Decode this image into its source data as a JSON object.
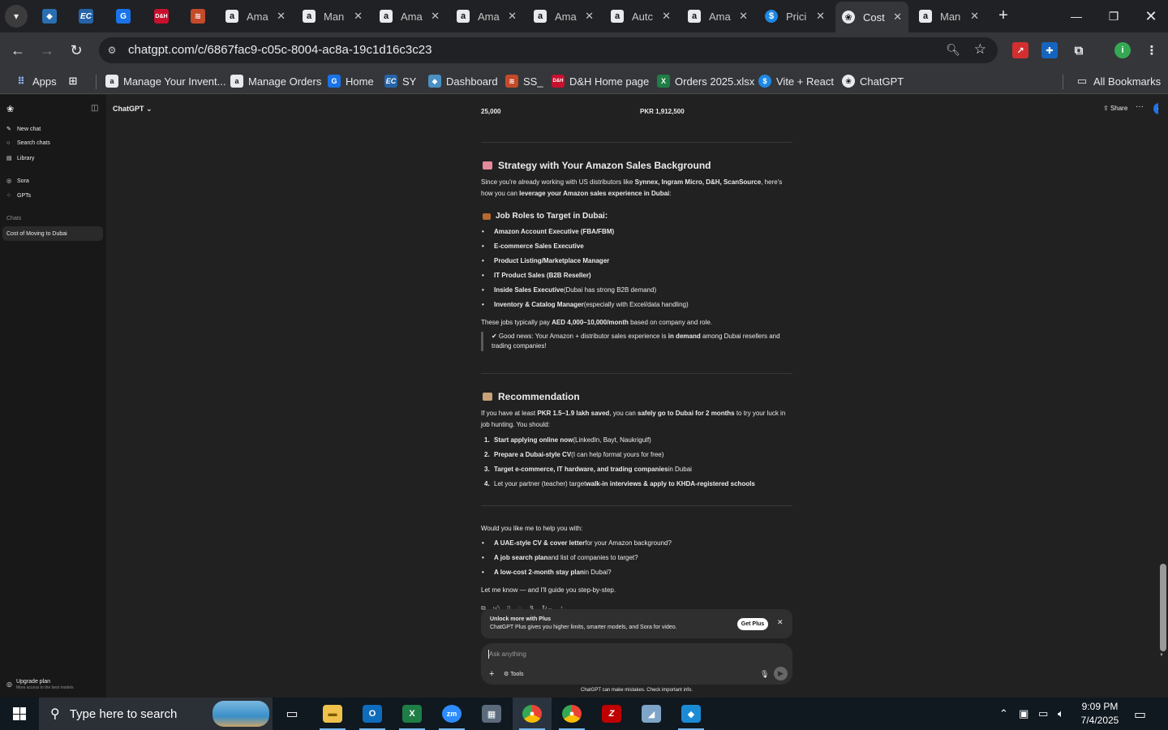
{
  "browser": {
    "tabs": [
      {
        "label": "Ama",
        "favicon": "amazon-icon"
      },
      {
        "label": "Man",
        "favicon": "amazon-icon"
      },
      {
        "label": "Ama",
        "favicon": "amazon-icon"
      },
      {
        "label": "Ama",
        "favicon": "amazon-icon"
      },
      {
        "label": "Ama",
        "favicon": "amazon-icon"
      },
      {
        "label": "Autc",
        "favicon": "amazon-icon"
      },
      {
        "label": "Ama",
        "favicon": "amazon-icon"
      },
      {
        "label": "Prici",
        "favicon": "dollar-icon"
      },
      {
        "label": "Cost",
        "favicon": "chatgpt-icon",
        "active": true
      },
      {
        "label": "Man",
        "favicon": "amazon-icon"
      }
    ],
    "url": "chatgpt.com/c/6867fac9-c05c-8004-ac8a-19c1d16c3c23",
    "bookmarks": [
      {
        "label": "Apps",
        "icon": "apps-grid-icon"
      },
      {
        "label": "Manage Your Invent...",
        "icon": "amazon-icon"
      },
      {
        "label": "Manage Orders",
        "icon": "amazon-icon"
      },
      {
        "label": "Home",
        "icon": "home-icon"
      },
      {
        "label": "SY",
        "icon": "ec-icon"
      },
      {
        "label": "Dashboard",
        "icon": "dashboard-icon"
      },
      {
        "label": "SS_",
        "icon": "ss-icon"
      },
      {
        "label": "D&H Home page",
        "icon": "dh-icon"
      },
      {
        "label": "Orders 2025.xlsx",
        "icon": "excel-icon"
      },
      {
        "label": "Vite + React",
        "icon": "dollar-icon"
      },
      {
        "label": "ChatGPT",
        "icon": "chatgpt-icon"
      }
    ],
    "all_bookmarks": "All Bookmarks",
    "profile_initial": "i"
  },
  "sidebar": {
    "items": [
      "New chat",
      "Search chats",
      "Library",
      "Sora",
      "GPTs"
    ],
    "section": "Chats",
    "chats": [
      "Cost of Moving to Dubai"
    ],
    "upgrade_title": "Upgrade plan",
    "upgrade_sub": "More access to the best models"
  },
  "topbar": {
    "model": "ChatGPT",
    "share": "Share"
  },
  "message": {
    "table_row": {
      "left": "25,000",
      "right": "PKR 1,912,500"
    },
    "strategy_heading": "Strategy with Your Amazon Sales Background",
    "strategy_p1": "Since you're already working with US distributors like ",
    "strategy_p1b": "Synnex, Ingram Micro, D&H, ScanSource",
    "strategy_p1c": ", here's how you can ",
    "strategy_p1d": "leverage your Amazon sales experience in Dubai",
    "strategy_p1e": ":",
    "jobs_heading": "Job Roles to Target in Dubai:",
    "jobs": [
      {
        "bold": "Amazon Account Executive (FBA/FBM)",
        "rest": ""
      },
      {
        "bold": "E-commerce Sales Executive",
        "rest": ""
      },
      {
        "bold": "Product Listing/Marketplace Manager",
        "rest": ""
      },
      {
        "bold": "IT Product Sales (B2B Reseller)",
        "rest": ""
      },
      {
        "bold": "Inside Sales Executive",
        "rest": " (Dubai has strong B2B demand)"
      },
      {
        "bold": "Inventory & Catalog Manager",
        "rest": " (especially with Excel/data handling)"
      }
    ],
    "pay_a": "These jobs typically pay ",
    "pay_b": "AED 4,000–10,000/month",
    "pay_c": " based on company and role.",
    "quote_a": "✔ Good news: Your Amazon + distributor sales experience is ",
    "quote_b": "in demand",
    "quote_c": " among Dubai resellers and trading companies!",
    "rec_heading": "Recommendation",
    "rec_a": "If you have at least ",
    "rec_b": "PKR 1.5–1.9 lakh saved",
    "rec_c": ", you can ",
    "rec_d": "safely go to Dubai for 2 months",
    "rec_e": " to try your luck in job hunting. You should:",
    "steps": [
      {
        "n": "1.",
        "bold": "Start applying online now",
        "rest": " (LinkedIn, Bayt, Naukrigulf)"
      },
      {
        "n": "2.",
        "bold": "Prepare a Dubai-style CV",
        "rest": " (I can help format yours for free)"
      },
      {
        "n": "3.",
        "bold": "Target e-commerce, IT hardware, and trading companies",
        "rest": " in Dubai"
      },
      {
        "n": "4.",
        "bold": "Let your partner (teacher) target ",
        "bold2": "walk-in interviews & apply to KHDA-registered schools",
        "rest": ""
      }
    ],
    "help_intro": "Would you like me to help you with:",
    "help": [
      {
        "bold": "A UAE-style CV & cover letter",
        "rest": " for your Amazon background?"
      },
      {
        "bold": "A job search plan",
        "rest": " and list of companies to target?"
      },
      {
        "bold": "A low-cost 2-month stay plan",
        "rest": " in Dubai?"
      }
    ],
    "closing": "Let me know — and I'll guide you step-by-step."
  },
  "plus_card": {
    "title": "Unlock more with Plus",
    "subtitle": "ChatGPT Plus gives you higher limits, smarter models, and Sora for video.",
    "button": "Get Plus"
  },
  "composer": {
    "placeholder": "Ask anything",
    "tools": "Tools"
  },
  "disclaimer": "ChatGPT can make mistakes. Check important info.",
  "taskbar": {
    "search_placeholder": "Type here to search",
    "time": "9:09 PM",
    "date": "7/4/2025"
  },
  "colors": {
    "accent_blue": "#1e73e8",
    "page_bg": "#212121",
    "sidebar_bg": "#181818"
  }
}
